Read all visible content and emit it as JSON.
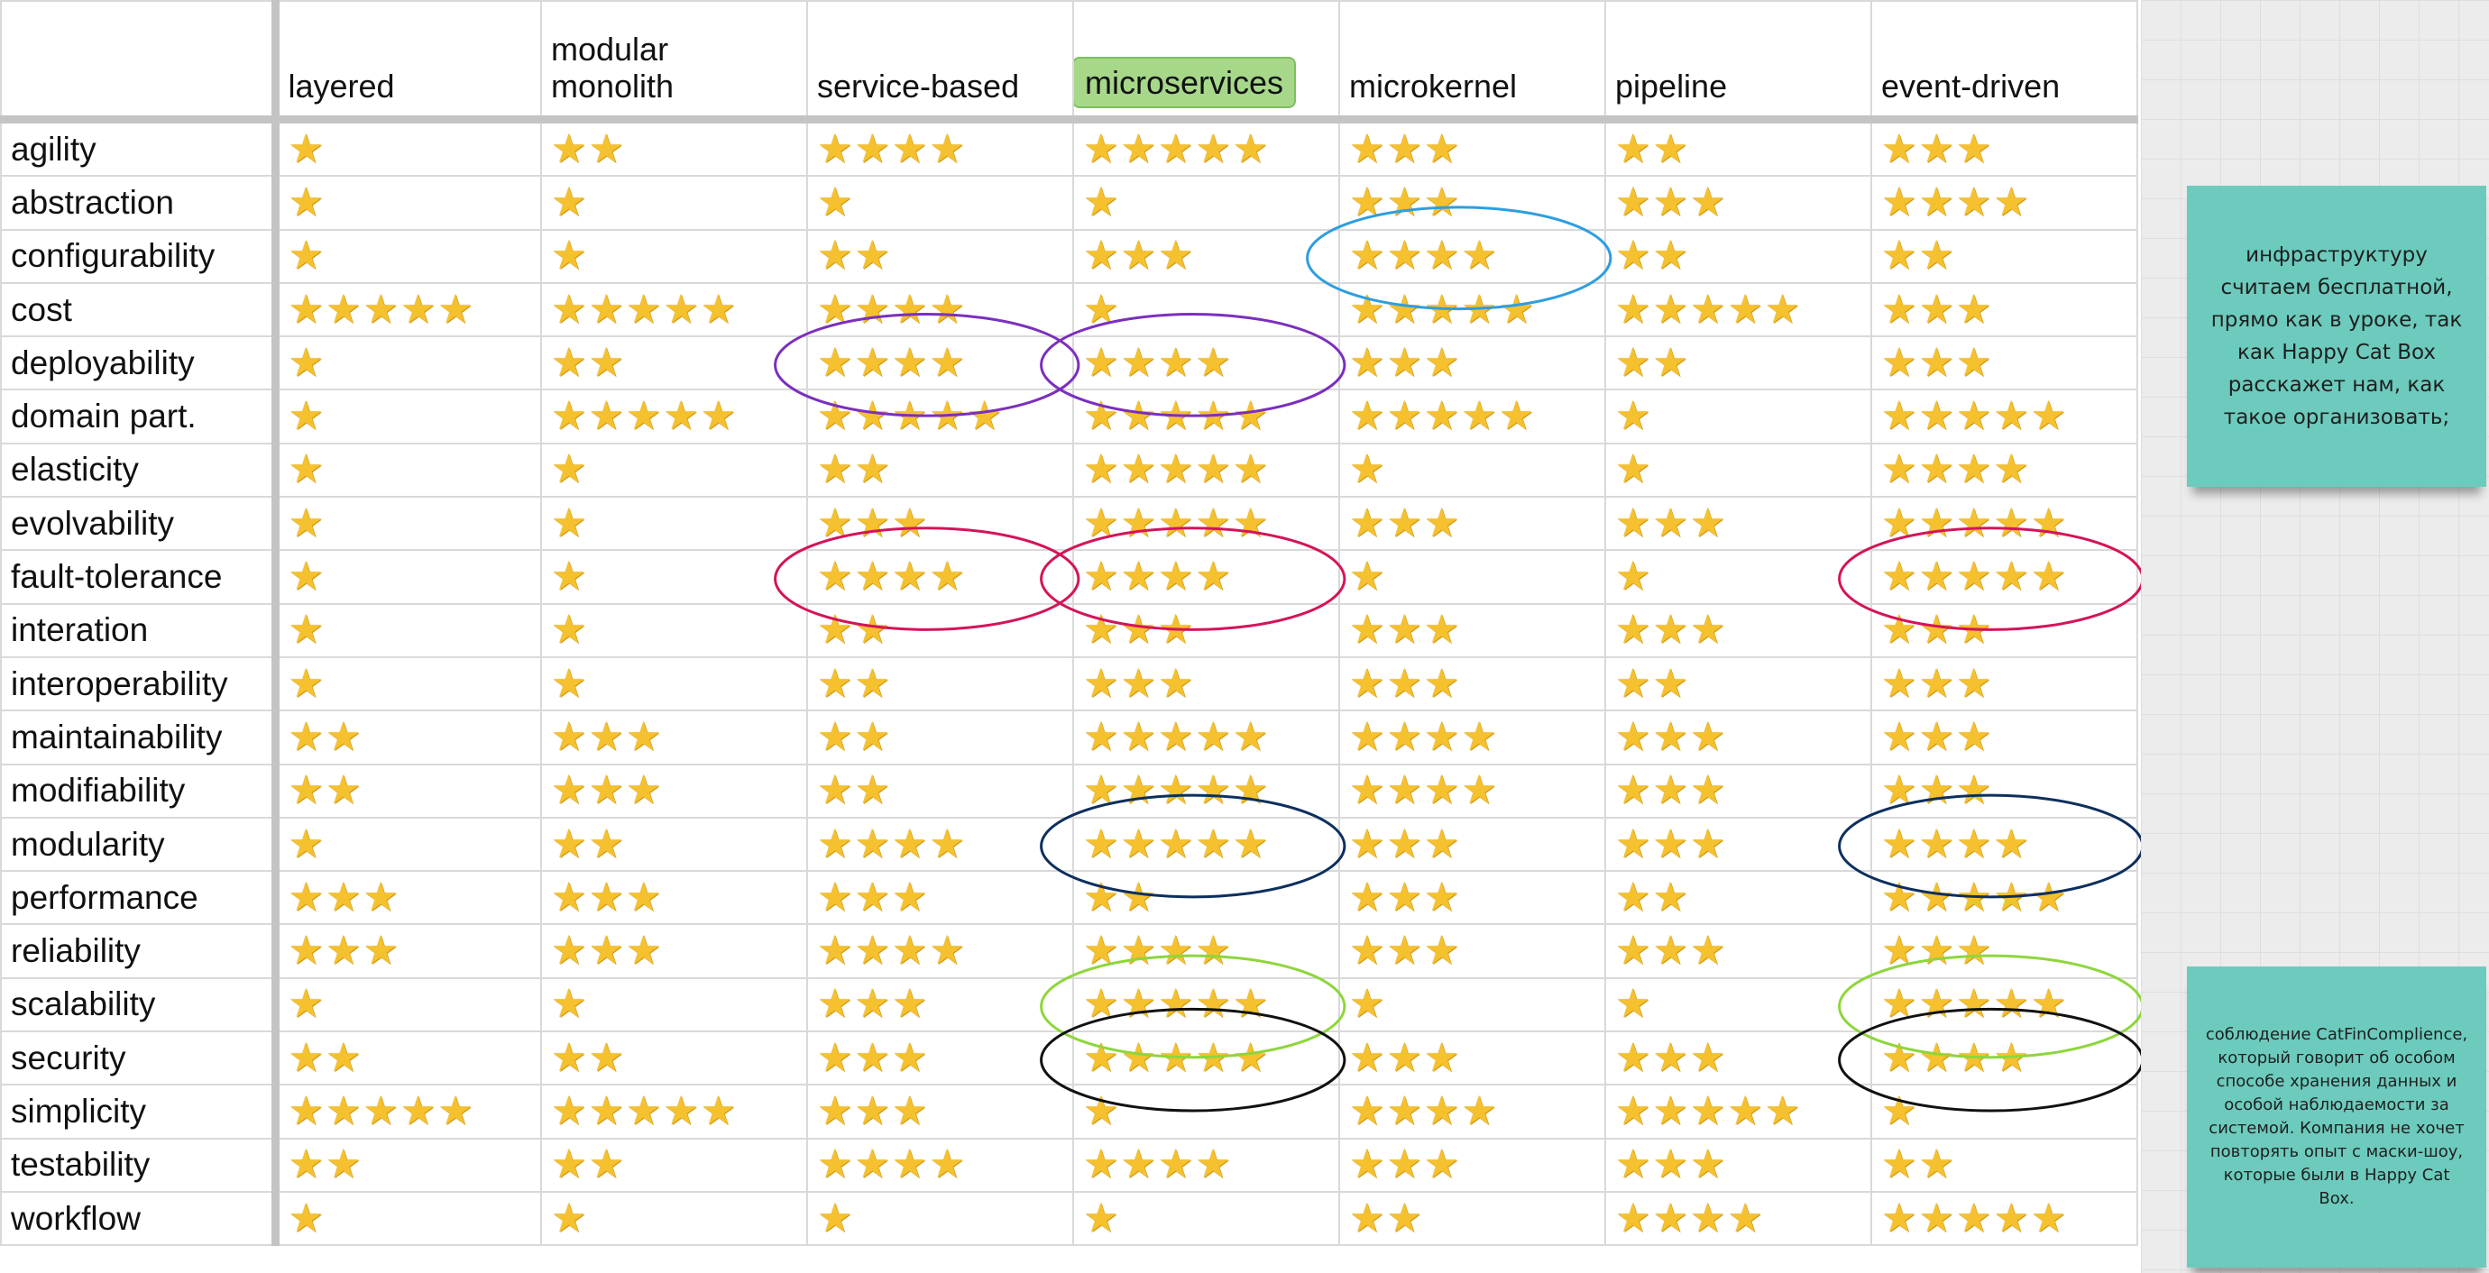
{
  "columns": [
    "layered",
    "modular monolith",
    "service-based",
    "microservices",
    "microkernel",
    "pipeline",
    "event-driven"
  ],
  "highlighted_column": "microservices",
  "highlight_color": "#a7d88a",
  "star_glyph": "★",
  "rows": [
    {
      "label": "agility",
      "ratings": [
        1,
        2,
        4,
        5,
        3,
        2,
        3
      ]
    },
    {
      "label": "abstraction",
      "ratings": [
        1,
        1,
        1,
        1,
        3,
        3,
        4
      ]
    },
    {
      "label": "configurability",
      "ratings": [
        1,
        1,
        2,
        3,
        4,
        2,
        2
      ]
    },
    {
      "label": "cost",
      "ratings": [
        5,
        5,
        4,
        1,
        5,
        5,
        3
      ]
    },
    {
      "label": "deployability",
      "ratings": [
        1,
        2,
        4,
        4,
        3,
        2,
        3
      ]
    },
    {
      "label": "domain part.",
      "ratings": [
        1,
        5,
        5,
        5,
        5,
        1,
        5
      ]
    },
    {
      "label": "elasticity",
      "ratings": [
        1,
        1,
        2,
        5,
        1,
        1,
        4
      ]
    },
    {
      "label": "evolvability",
      "ratings": [
        1,
        1,
        3,
        5,
        3,
        3,
        5
      ]
    },
    {
      "label": "fault-tolerance",
      "ratings": [
        1,
        1,
        4,
        4,
        1,
        1,
        5
      ]
    },
    {
      "label": "interation",
      "ratings": [
        1,
        1,
        2,
        3,
        3,
        3,
        3
      ]
    },
    {
      "label": "interoperability",
      "ratings": [
        1,
        1,
        2,
        3,
        3,
        2,
        3
      ]
    },
    {
      "label": "maintainability",
      "ratings": [
        2,
        3,
        2,
        5,
        4,
        3,
        3
      ]
    },
    {
      "label": "modifiability",
      "ratings": [
        2,
        3,
        2,
        5,
        4,
        3,
        3
      ]
    },
    {
      "label": "modularity",
      "ratings": [
        1,
        2,
        4,
        5,
        3,
        3,
        4
      ]
    },
    {
      "label": "performance",
      "ratings": [
        3,
        3,
        3,
        2,
        3,
        2,
        5
      ]
    },
    {
      "label": "reliability",
      "ratings": [
        3,
        3,
        4,
        4,
        3,
        3,
        3
      ]
    },
    {
      "label": "scalability",
      "ratings": [
        1,
        1,
        3,
        5,
        1,
        1,
        5
      ]
    },
    {
      "label": "security",
      "ratings": [
        2,
        2,
        3,
        5,
        3,
        3,
        4
      ]
    },
    {
      "label": "simplicity",
      "ratings": [
        5,
        5,
        3,
        1,
        4,
        5,
        1
      ]
    },
    {
      "label": "testability",
      "ratings": [
        2,
        2,
        4,
        4,
        3,
        3,
        2
      ]
    },
    {
      "label": "workflow",
      "ratings": [
        1,
        1,
        1,
        1,
        2,
        4,
        5
      ]
    }
  ],
  "ellipses": [
    {
      "row": "configurability",
      "column": "microkernel",
      "color": "#2e9ee0"
    },
    {
      "row": "deployability",
      "column": "service-based",
      "color": "#7b2fbe"
    },
    {
      "row": "deployability",
      "column": "microservices",
      "color": "#7b2fbe"
    },
    {
      "row": "fault-tolerance",
      "column": "service-based",
      "color": "#d4145a"
    },
    {
      "row": "fault-tolerance",
      "column": "microservices",
      "color": "#d4145a"
    },
    {
      "row": "fault-tolerance",
      "column": "event-driven",
      "color": "#d4145a"
    },
    {
      "row": "modularity",
      "column": "microservices",
      "color": "#0d2f5e"
    },
    {
      "row": "modularity",
      "column": "event-driven",
      "color": "#0d2f5e"
    },
    {
      "row": "scalability",
      "column": "microservices",
      "color": "#8ed63c"
    },
    {
      "row": "scalability",
      "column": "event-driven",
      "color": "#8ed63c"
    },
    {
      "row": "security",
      "column": "microservices",
      "color": "#111111"
    },
    {
      "row": "security",
      "column": "event-driven",
      "color": "#111111"
    }
  ],
  "sticky_notes": [
    {
      "text": "инфраструктуру считаем бесплатной, прямо как в уроке, так как Happy Cat Box расскажет нам, как такое организовать;",
      "color": "#6ccbbd"
    },
    {
      "text": "соблюдение CatFinComplience, который говорит об особом способе хранения данных и особой наблюдаемости за системой. Компания не хочет повторять опыт с маски-шоу, которые были в Happy Cat Box.",
      "color": "#6ccbbd"
    }
  ]
}
